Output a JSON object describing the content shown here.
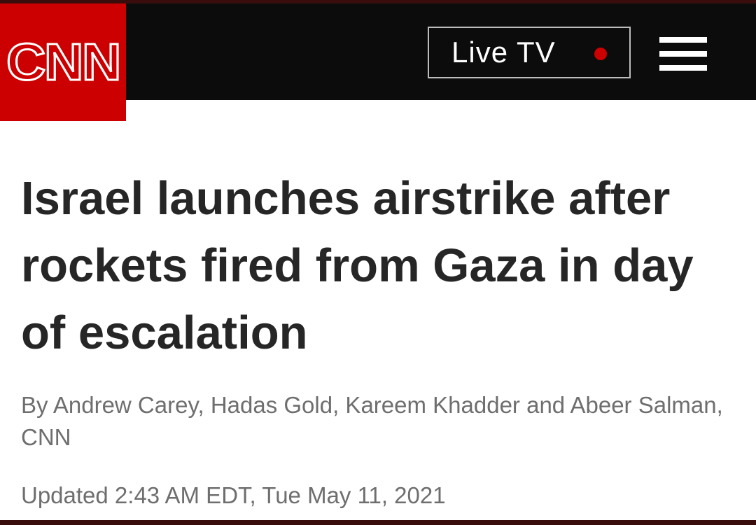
{
  "header": {
    "logo_text": "CNN",
    "live_label": "Live TV",
    "menu_icon": "hamburger-menu-icon",
    "live_indicator_icon": "live-dot-icon",
    "brand_color": "#cc0000",
    "header_bg": "#0c0c0c"
  },
  "article": {
    "headline": "Israel launches airstrike after rockets fired from Gaza in day of escalation",
    "byline": "By Andrew Carey, Hadas Gold, Kareem Khadder and Abeer Salman, CNN",
    "updated": "Updated 2:43 AM EDT, Tue May 11, 2021"
  }
}
